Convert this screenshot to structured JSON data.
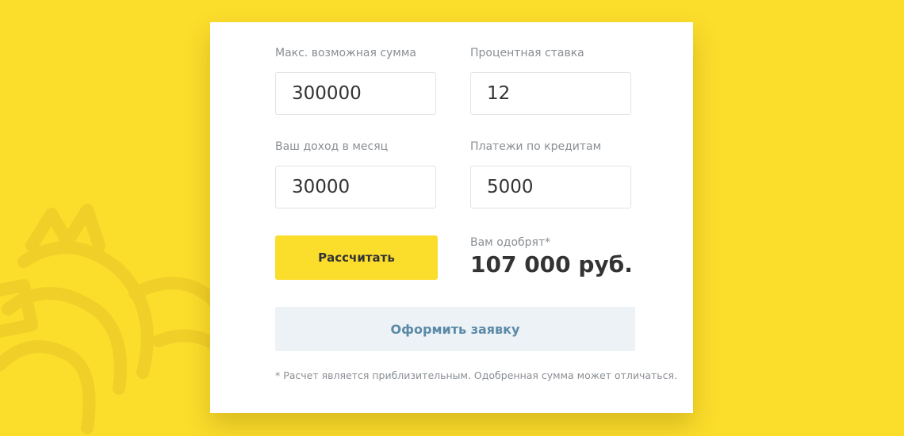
{
  "form": {
    "max_amount": {
      "label": "Макс. возможная сумма",
      "value": "300000"
    },
    "interest_rate": {
      "label": "Процентная ставка",
      "value": "12"
    },
    "monthly_income": {
      "label": "Ваш доход в месяц",
      "value": "30000"
    },
    "credit_payments": {
      "label": "Платежи по кредитам",
      "value": "5000"
    },
    "calculate_label": "Рассчитать",
    "result_label": "Вам одобрят*",
    "result_value": "107 000 руб.",
    "apply_label": "Оформить заявку",
    "footnote": "* Расчет является приблизительным. Одобренная сумма может отличаться."
  },
  "colors": {
    "background": "#fbdd2c",
    "accent": "#fbdd2c",
    "apply_text": "#5a8aa6",
    "apply_bg": "#edf2f7"
  },
  "icons": {
    "background_emblem": "griffin-emblem-icon"
  }
}
